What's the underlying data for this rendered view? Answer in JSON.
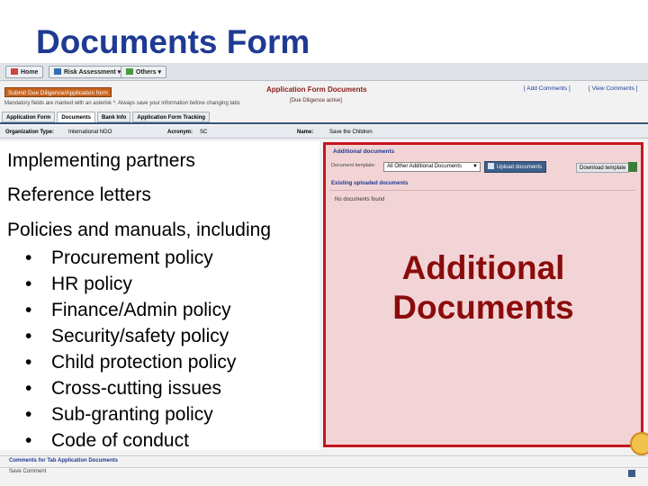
{
  "slide": {
    "title": "Documents Form"
  },
  "app": {
    "nav": {
      "home": "Home",
      "risk_assessment": "Risk Assessment ▾",
      "others": "Others ▾"
    },
    "submit_button": "Submit Due Diligence/Application form",
    "mandatory_note": "Mandatory fields are marked with an asterisk *. Always save your information before changing tabs",
    "page_title": "Application Form Documents",
    "status": "[Due Diligence active]",
    "links": {
      "add_comments": "[ Add Comments ]",
      "view_comments": "[ View Comments ]"
    },
    "tabs": [
      "Application Form",
      "Documents",
      "Bank Info",
      "Application Form Tracking"
    ],
    "org": {
      "type_label": "Organization Type:",
      "type_value": "International NGO",
      "acronym_label": "Acronym:",
      "acronym_value": "SC",
      "name_label": "Name:",
      "name_value": "Save the Children"
    },
    "comments_title": "Comments for Tab Application Documents",
    "save_comment": "Save Comment"
  },
  "left_text": {
    "para1": "Implementing partners",
    "para2": "Reference letters",
    "para3": "Policies and manuals, including",
    "bullets": [
      "Procurement policy",
      "HR policy",
      "Finance/Admin policy",
      "Security/safety policy",
      "Child protection policy",
      "Cross-cutting issues",
      "Sub-granting policy",
      "Code of conduct"
    ],
    "bullet_glyph": "•"
  },
  "panel": {
    "header": "Additional documents",
    "document_label": "Document template:",
    "select_value": "All Other Additional Documents",
    "upload_button": "Upload documents",
    "template_button": "Download template",
    "existing_header": "Existing uploaded documents",
    "no_docs": "No documents found",
    "big_label_line1": "Additional",
    "big_label_line2": "Documents",
    "highlight_color": "#c8161d",
    "fill_color": "#f2d4d6"
  }
}
